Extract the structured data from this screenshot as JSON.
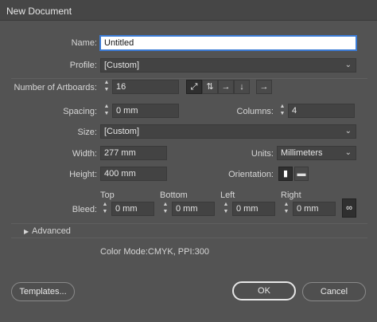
{
  "window": {
    "title": "New Document"
  },
  "name": {
    "label": "Name:",
    "value": "Untitled"
  },
  "profile": {
    "label": "Profile:",
    "value": "[Custom]"
  },
  "artboards": {
    "label": "Number of Artboards:",
    "value": "16",
    "right_arrow": "→"
  },
  "spacing": {
    "label": "Spacing:",
    "value": "0 mm"
  },
  "columns": {
    "label": "Columns:",
    "value": "4"
  },
  "size": {
    "label": "Size:",
    "value": "[Custom]"
  },
  "width": {
    "label": "Width:",
    "value": "277 mm"
  },
  "units": {
    "label": "Units:",
    "value": "Millimeters"
  },
  "height": {
    "label": "Height:",
    "value": "400 mm"
  },
  "orientation": {
    "label": "Orientation:"
  },
  "bleed": {
    "label": "Bleed:",
    "top": {
      "label": "Top",
      "value": "0 mm"
    },
    "bottom": {
      "label": "Bottom",
      "value": "0 mm"
    },
    "left": {
      "label": "Left",
      "value": "0 mm"
    },
    "right": {
      "label": "Right",
      "value": "0 mm"
    }
  },
  "advanced": {
    "label": "Advanced"
  },
  "info": {
    "text": "Color Mode:CMYK, PPI:300"
  },
  "buttons": {
    "templates": "Templates...",
    "ok": "OK",
    "cancel": "Cancel"
  }
}
